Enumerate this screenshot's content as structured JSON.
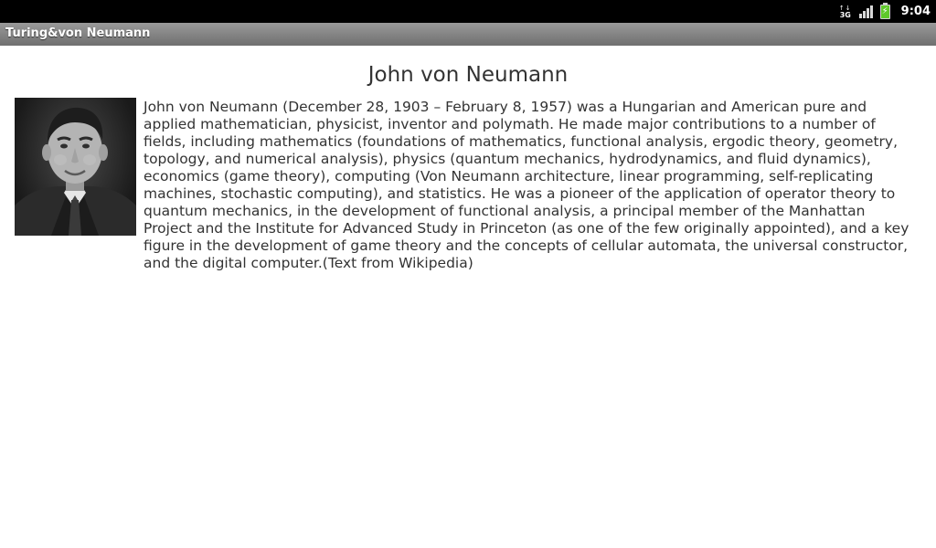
{
  "status_bar": {
    "network": "3G",
    "time": "9:04",
    "icons": [
      "data-3g-icon",
      "signal-strength-icon",
      "battery-charging-icon"
    ]
  },
  "title_bar": {
    "title": "Turing&von Neumann"
  },
  "main": {
    "heading": "John von Neumann",
    "portrait": {
      "alt": "John von Neumann"
    },
    "bio": "John von Neumann (December 28, 1903 – February 8, 1957) was a Hungarian and American pure and applied mathematician, physicist, inventor and polymath. He made major contributions to a number of fields, including mathematics (foundations of mathematics, functional analysis, ergodic theory, geometry, topology, and numerical analysis), physics (quantum mechanics, hydrodynamics, and fluid dynamics), economics (game theory), computing (Von Neumann architecture, linear programming, self-replicating machines, stochastic computing), and statistics. He was a pioneer of the application of operator theory to quantum mechanics, in the development of functional analysis, a principal member of the Manhattan Project and the Institute for Advanced Study in Princeton (as one of the few originally appointed), and a key figure in the development of game theory and the concepts of cellular automata, the universal constructor, and the digital computer.(Text from Wikipedia)"
  }
}
